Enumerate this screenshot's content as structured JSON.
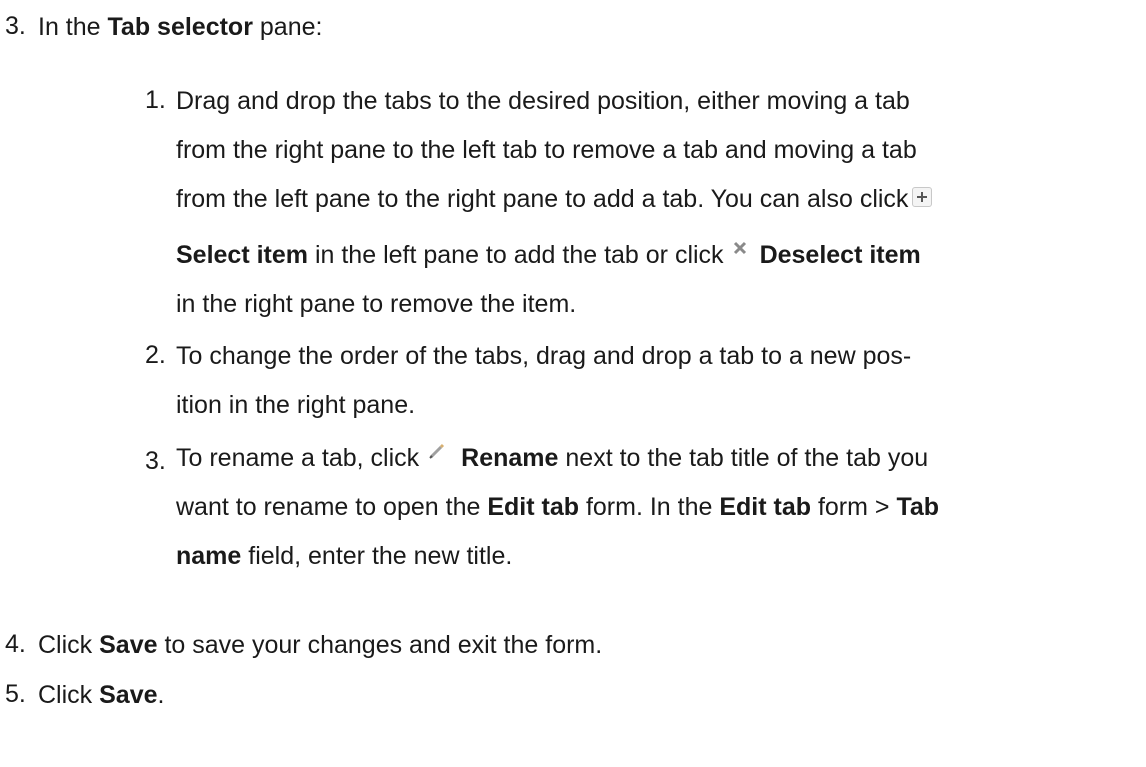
{
  "steps": {
    "s3": {
      "number": "3.",
      "intro": "In the ",
      "pane": "Tab selector",
      "rest": " pane:"
    },
    "sub1": {
      "number": "1.",
      "line1": "Drag and drop the tabs to the desired position, either moving a tab",
      "line2": "from the right pane to the left tab to remove a tab and moving a tab",
      "line3": "from the left pane to the right pane to add a tab. You can also click",
      "select_item": "Select item",
      "line4_mid": " in the left pane to add the tab or click",
      "deselect_item": "Deselect item",
      "line5": "in the right pane to remove the item."
    },
    "sub2": {
      "number": "2.",
      "line1": "To change the order of the tabs, drag and drop a tab to a new pos-",
      "line2": "ition in the right pane."
    },
    "sub3": {
      "number": "3.",
      "line1_pre": "To rename a tab, click",
      "rename": "Rename",
      "line1_post": " next to the tab title of the tab you",
      "line2_pre": "want to rename to open the ",
      "edit_tab": "Edit tab",
      "line2_mid": " form. In the ",
      "edit_tab2": "Edit tab",
      "line2_post": " form > ",
      "tab": "Tab",
      "name": "name",
      "line3_post": " field, enter the new title."
    },
    "s4": {
      "number": "4.",
      "pre": "Click ",
      "save": "Save",
      "post": " to save your changes and exit the form."
    },
    "s5": {
      "number": "5.",
      "pre": "Click ",
      "save": "Save",
      "post": "."
    }
  },
  "icons": {
    "select": "plus-icon",
    "deselect": "close-icon",
    "rename": "pencil-icon"
  }
}
